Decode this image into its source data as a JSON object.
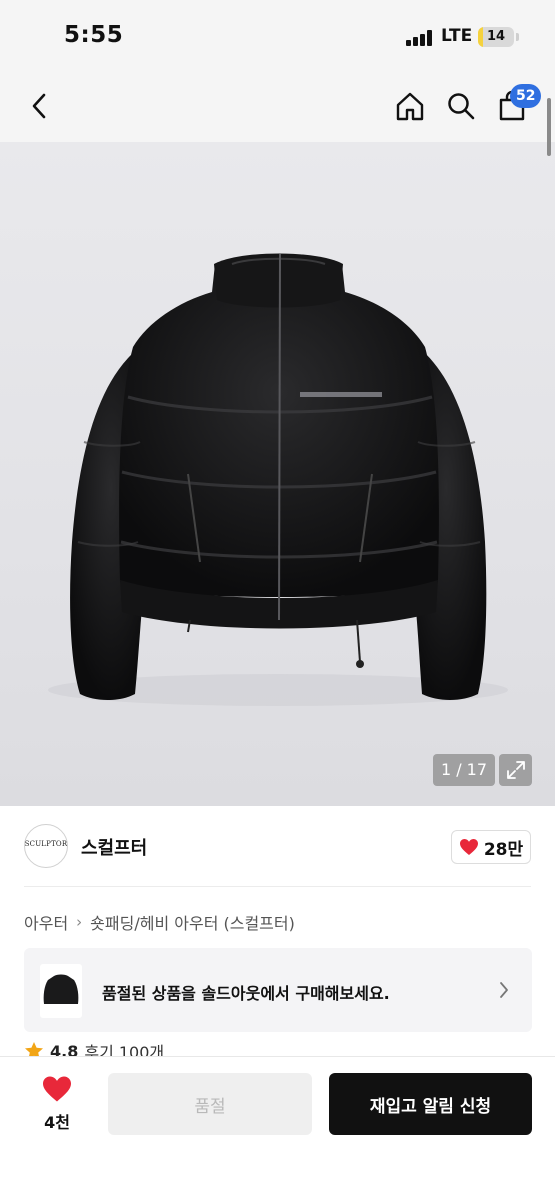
{
  "status_bar": {
    "time": "5:55",
    "network": "LTE",
    "battery": "14",
    "battery_level": 0.14,
    "battery_color": "#f5d23e"
  },
  "nav": {
    "back_icon": "chevron-left-icon",
    "home_icon": "home-icon",
    "search_icon": "search-icon",
    "cart_icon": "shopping-bag-icon",
    "cart_badge": "52",
    "badge_color": "#2f6fe0"
  },
  "gallery": {
    "counter": "1 / 17",
    "expand_icon": "expand-icon",
    "image_subject": "black-cropped-puffer-jacket"
  },
  "brand": {
    "logo_text": "SCULPTOR",
    "name": "스컬프터",
    "like_icon": "heart-icon",
    "like_count": "28만",
    "accent_color": "#e8283a"
  },
  "breadcrumb": {
    "items": [
      "아우터",
      "숏패딩/헤비 아우터 (스컬프터)"
    ]
  },
  "promo": {
    "text": "품절된 상품을 솔드아웃에서 구매해보세요.",
    "arrow_icon": "chevron-right-icon"
  },
  "rating": {
    "star_icon": "star-icon",
    "score": "4.8",
    "reviews": "후기 100개"
  },
  "bottom_bar": {
    "wish_icon": "heart-icon",
    "wish_count": "4천",
    "soldout_label": "품절",
    "restock_label": "재입고 알림 신청"
  }
}
